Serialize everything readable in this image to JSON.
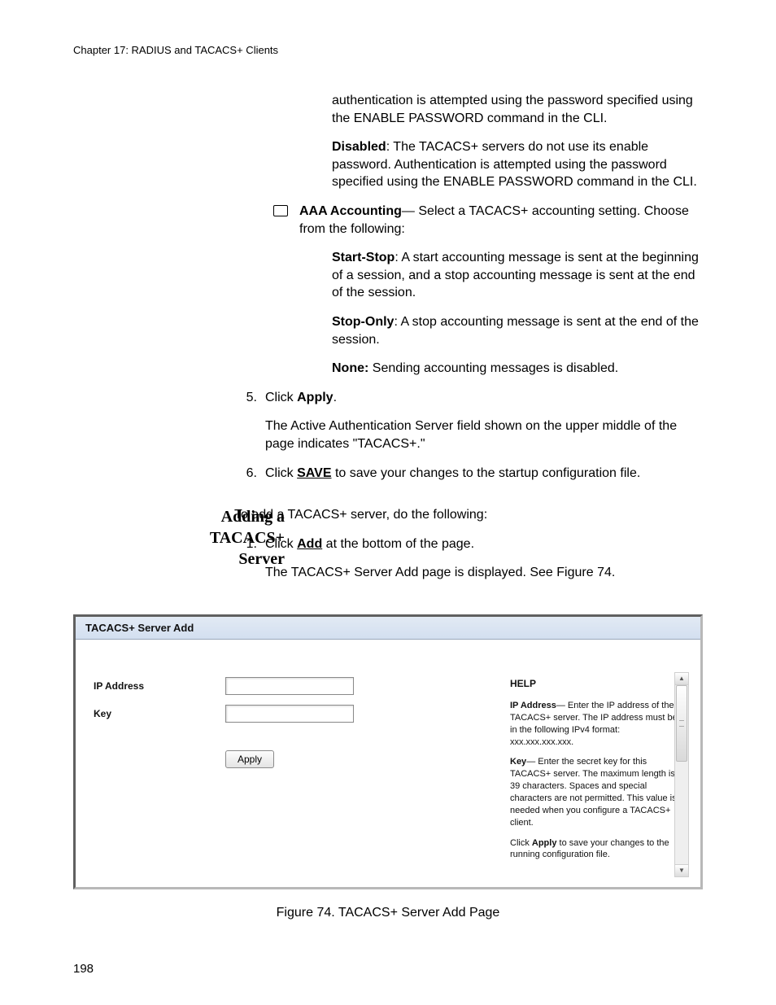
{
  "header": {
    "chapter": "Chapter 17: RADIUS and TACACS+ Clients"
  },
  "page_number": "198",
  "body": {
    "p1": "authentication is attempted using the password specified using the ENABLE PASSWORD command in the CLI.",
    "disabled_label": "Disabled",
    "disabled_text": ": The TACACS+ servers do not use its enable password. Authentication is attempted using the password specified using the ENABLE PASSWORD command in the CLI.",
    "aaa_label": "AAA Accounting",
    "aaa_text": "— Select a TACACS+ accounting setting. Choose from the following:",
    "startstop_label": "Start-Stop",
    "startstop_text": ": A start accounting message is sent at the beginning of a session, and a stop accounting message is sent at the end of the session.",
    "stoponly_label": "Stop-Only",
    "stoponly_text": ": A stop accounting message is sent at the end of the session.",
    "none_label": "None:",
    "none_text": " Sending accounting messages is disabled.",
    "step5_num": "5.",
    "step5_pre": "Click ",
    "step5_apply": "Apply",
    "step5_post": ".",
    "step5_follow": "The Active Authentication Server field shown on the upper middle of the page indicates \"TACACS+.\"",
    "step6_num": "6.",
    "step6_pre": "Click ",
    "step6_save": "SAVE",
    "step6_post": " to save your changes to the startup configuration file."
  },
  "side": {
    "heading_l1": "Adding a",
    "heading_l2": "TACACS+",
    "heading_l3": "Server",
    "intro": "To add a TACACS+ server, do the following:",
    "s1_num": "1.",
    "s1_pre": "Click ",
    "s1_add": "Add",
    "s1_post": " at the bottom of the page.",
    "s1_follow": "The TACACS+ Server Add page is displayed. See Figure 74."
  },
  "screenshot": {
    "title": "TACACS+ Server Add",
    "form": {
      "ip_label": "IP Address",
      "key_label": "Key",
      "apply": "Apply"
    },
    "help": {
      "heading": "HELP",
      "ip_lbl": "IP Address",
      "ip_txt": "— Enter the IP address of the TACACS+ server. The IP address must be in the following IPv4 format: xxx.xxx.xxx.xxx.",
      "key_lbl": "Key",
      "key_txt": "— Enter the secret key for this TACACS+ server. The maximum length is 39 characters. Spaces and special characters are not permitted. This value is needed when you configure a TACACS+ client.",
      "apply_lbl": "Apply",
      "apply_pre": "Click ",
      "apply_post": " to save your changes to the running configuration file."
    }
  },
  "figure_caption": "Figure 74. TACACS+ Server Add Page"
}
